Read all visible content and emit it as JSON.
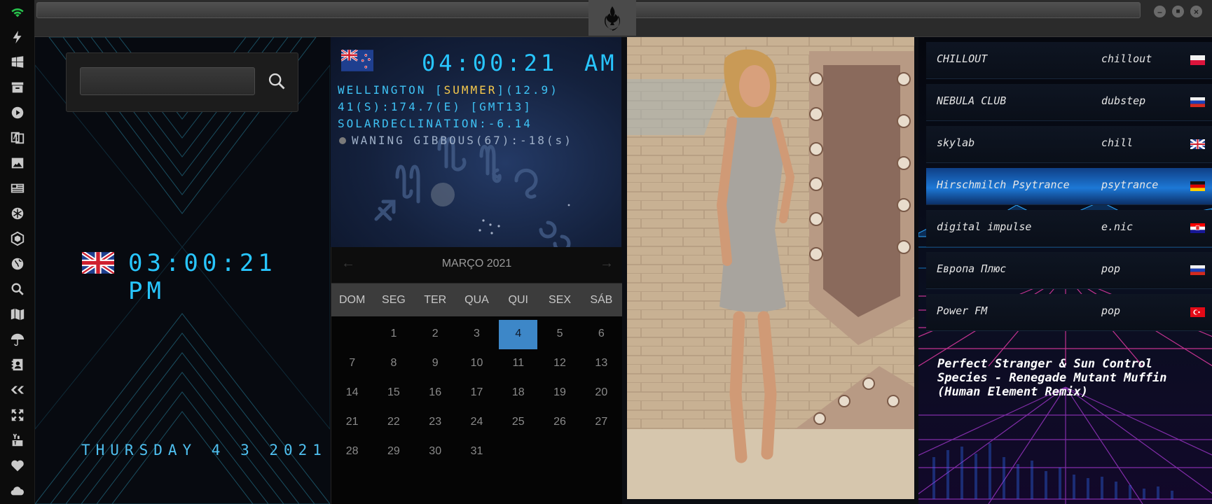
{
  "sidebar": {
    "icons": [
      "wifi-icon",
      "lightning-icon",
      "windows-icon",
      "archive-icon",
      "play-icon",
      "translate-icon",
      "image-icon",
      "news-icon",
      "snowflake-icon",
      "hexagon-icon",
      "globe-icon",
      "search-icon",
      "map-icon",
      "umbrella-icon",
      "contacts-icon",
      "tag-icon",
      "fullscreen-icon",
      "youtube-icon",
      "heart-icon",
      "cloud-icon"
    ]
  },
  "header": {
    "url_value": ""
  },
  "search": {
    "value": "",
    "placeholder": ""
  },
  "local_clock": {
    "time": "03:00:21 PM",
    "date": "THURSDAY 4 3 2021"
  },
  "world_clock": {
    "time": "04:00:21",
    "ampm": "AM",
    "city": "WELLINGTON",
    "season_open": " [",
    "season": "SUMMER",
    "season_close": "](12.9)",
    "coords": "41(S):174.7(E) [GMT13]",
    "solar": "SOLARDECLINATION:-6.14",
    "moon": "WANING GIBBOUS(67):-18(s)"
  },
  "calendar": {
    "title": "MARÇO 2021",
    "prev": "←",
    "next": "→",
    "weekdays": [
      "DOM",
      "SEG",
      "TER",
      "QUA",
      "QUI",
      "SEX",
      "SÁB"
    ],
    "weeks": [
      [
        "",
        "1",
        "2",
        "3",
        "4",
        "5",
        "6"
      ],
      [
        "7",
        "8",
        "9",
        "10",
        "11",
        "12",
        "13"
      ],
      [
        "14",
        "15",
        "16",
        "17",
        "18",
        "19",
        "20"
      ],
      [
        "21",
        "22",
        "23",
        "24",
        "25",
        "26",
        "27"
      ],
      [
        "28",
        "29",
        "30",
        "31",
        "",
        "",
        ""
      ]
    ],
    "today": "4"
  },
  "radio": {
    "stations": [
      {
        "name": "CHILLOUT",
        "genre": "chillout",
        "flag": "poland"
      },
      {
        "name": "NEBULA CLUB",
        "genre": "dubstep",
        "flag": "russia"
      },
      {
        "name": "skylab",
        "genre": "chill",
        "flag": "uk"
      },
      {
        "name": "Hirschmilch Psytrance",
        "genre": "psytrance",
        "flag": "germany"
      },
      {
        "name": "digital impulse",
        "genre": "e.nic",
        "flag": "croatia"
      },
      {
        "name": "Европа Плюс",
        "genre": "pop",
        "flag": "russia"
      },
      {
        "name": "Power FM",
        "genre": "pop",
        "flag": "turkey"
      }
    ],
    "active_index": 3,
    "now_playing": [
      "Perfect Stranger & Sun Control",
      "Species - Renegade Mutant Muffin",
      "(Human Element Remix)"
    ]
  },
  "colors": {
    "accent": "#28c6ff",
    "today_highlight": "#3d87c8",
    "active_station": "#1d78d6",
    "wifi": "#27c24c"
  }
}
